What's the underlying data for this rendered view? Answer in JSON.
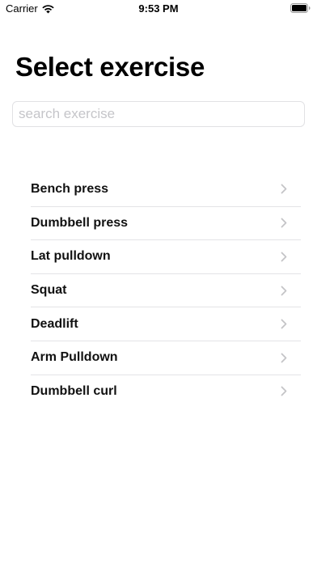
{
  "status_bar": {
    "carrier": "Carrier",
    "time": "9:53 PM"
  },
  "page": {
    "title": "Select exercise"
  },
  "search": {
    "placeholder": "search exercise",
    "value": ""
  },
  "exercises": [
    {
      "label": "Bench press"
    },
    {
      "label": "Dumbbell press"
    },
    {
      "label": "Lat pulldown"
    },
    {
      "label": "Squat"
    },
    {
      "label": "Deadlift"
    },
    {
      "label": "Arm Pulldown"
    },
    {
      "label": "Dumbbell curl"
    }
  ],
  "icons": {
    "wifi": "wifi-icon",
    "battery": "battery-icon",
    "row_chevron": "chevron-right-icon"
  },
  "colors": {
    "text": "#000000",
    "placeholder": "#c5c5c9",
    "separator": "#e3e3e6",
    "chevron": "#c4c4c7"
  }
}
